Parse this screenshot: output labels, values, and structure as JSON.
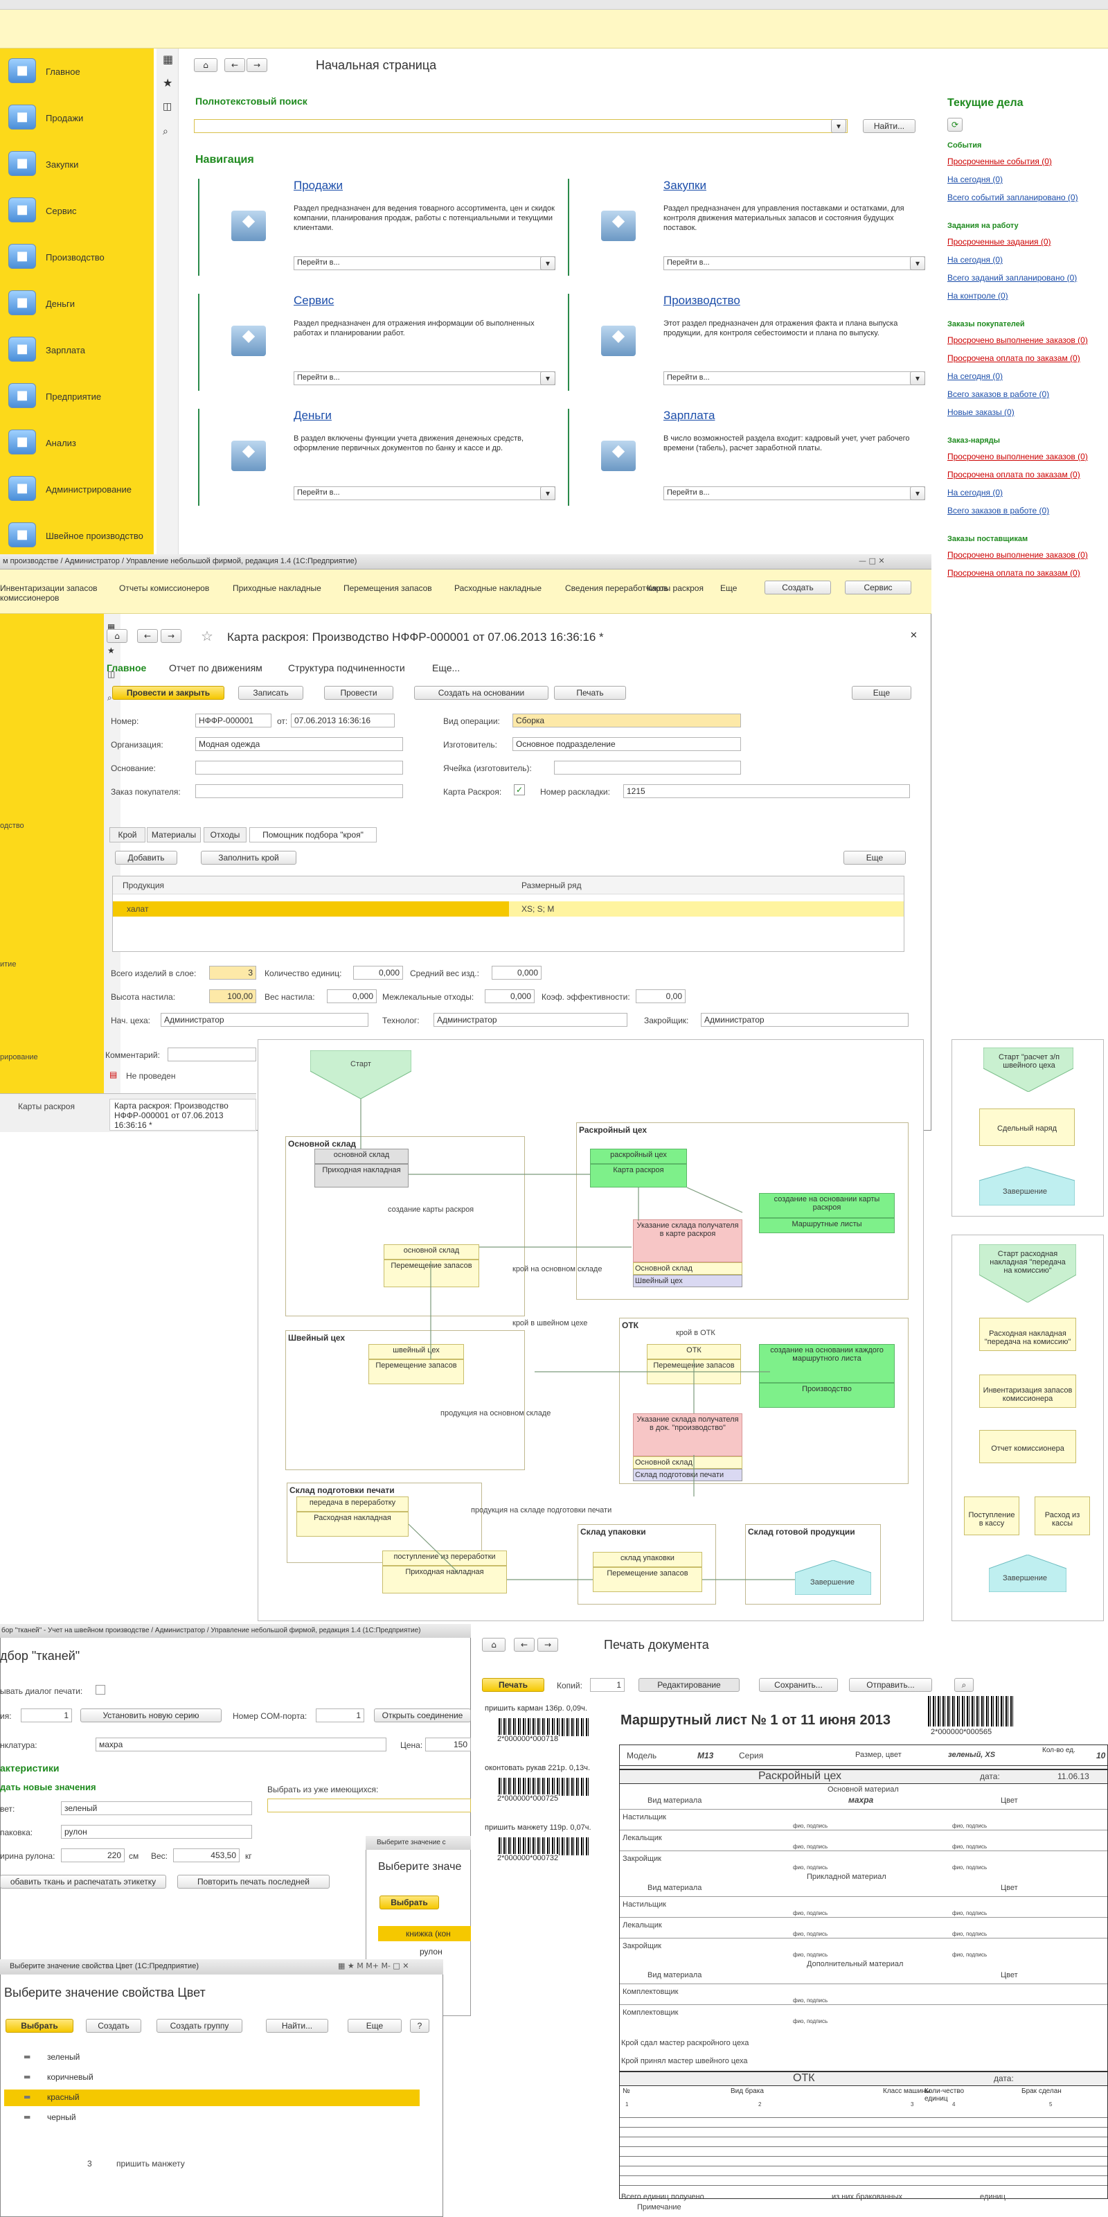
{
  "home": {
    "sidebar": [
      {
        "label": "Главное",
        "icon": "home-icon"
      },
      {
        "label": "Продажи",
        "icon": "cash-register-icon"
      },
      {
        "label": "Закупки",
        "icon": "boxes-icon"
      },
      {
        "label": "Сервис",
        "icon": "tools-icon"
      },
      {
        "label": "Производство",
        "icon": "factory-icon"
      },
      {
        "label": "Деньги",
        "icon": "money-bags-icon"
      },
      {
        "label": "Зарплата",
        "icon": "person-icon"
      },
      {
        "label": "Предприятие",
        "icon": "building-icon"
      },
      {
        "label": "Анализ",
        "icon": "chart-icon"
      },
      {
        "label": "Администрирование",
        "icon": "computer-icon"
      },
      {
        "label": "Швейное производство",
        "icon": "sewing-machine-icon"
      }
    ],
    "title": "Начальная страница",
    "search_heading": "Полнотекстовый поиск",
    "find_btn": "Найти...",
    "nav_heading": "Навигация",
    "goto": "Перейти в...",
    "sections": [
      {
        "title": "Продажи",
        "desc": "Раздел предназначен для ведения товарного ассортимента, цен и скидок компании, планирования продаж, работы с потенциальными и текущими клиентами."
      },
      {
        "title": "Закупки",
        "desc": "Раздел предназначен для управления поставками и остатками, для контроля движения материальных запасов и состояния будущих поставок."
      },
      {
        "title": "Сервис",
        "desc": "Раздел предназначен для отражения информации об выполненных работах и планировании работ."
      },
      {
        "title": "Производство",
        "desc": "Этот раздел предназначен для отражения факта и плана выпуска продукции, для контроля себестоимости и плана по выпуску."
      },
      {
        "title": "Деньги",
        "desc": "В раздел включены функции учета движения денежных средств, оформление первичных документов по банку и кассе и др."
      },
      {
        "title": "Зарплата",
        "desc": "В число возможностей раздела входит: кадровый учет, учет рабочего времени (табель), расчет заработной платы."
      }
    ],
    "current_heading": "Текущие дела",
    "groups": [
      {
        "title": "События",
        "items": [
          {
            "t": "Просроченные события (0)",
            "red": true
          },
          {
            "t": "На сегодня (0)"
          },
          {
            "t": "Всего событий запланировано (0)"
          }
        ]
      },
      {
        "title": "Задания на работу",
        "items": [
          {
            "t": "Просроченные задания (0)",
            "red": true
          },
          {
            "t": "На сегодня (0)"
          },
          {
            "t": "Всего заданий запланировано (0)"
          },
          {
            "t": "На контроле (0)"
          }
        ]
      },
      {
        "title": "Заказы покупателей",
        "items": [
          {
            "t": "Просрочено выполнение заказов (0)",
            "red": true
          },
          {
            "t": "Просрочена оплата по заказам (0)",
            "red": true
          },
          {
            "t": "На сегодня (0)"
          },
          {
            "t": "Всего заказов в работе (0)"
          },
          {
            "t": "Новые заказы (0)"
          }
        ]
      },
      {
        "title": "Заказ-наряды",
        "items": [
          {
            "t": "Просрочено выполнение заказов (0)",
            "red": true
          },
          {
            "t": "Просрочена оплата по заказам (0)",
            "red": true
          },
          {
            "t": "На сегодня (0)"
          },
          {
            "t": "Всего заказов в работе (0)"
          }
        ]
      },
      {
        "title": "Заказы поставщикам",
        "items": [
          {
            "t": "Просрочено выполнение заказов (0)",
            "red": true
          },
          {
            "t": "Просрочена оплата по заказам (0)",
            "red": true
          }
        ]
      }
    ]
  },
  "doc": {
    "window_title": "м производстве / Администратор / Управление небольшой фирмой, редакция 1.4 (1С:Предприятие)",
    "toolbar": [
      "Инвентаризации запасов комиссионеров",
      "Отчеты комиссионеров",
      "Приходные накладные",
      "Перемещения запасов",
      "Расходные накладные",
      "Сведения переработчиков",
      "Карты раскроя",
      "Еще",
      "Создать",
      "Сервис"
    ],
    "title": "Карта раскроя: Производство НФФР-000001 от 07.06.2013 16:36:16 *",
    "tabs": [
      "Главное",
      "Отчет по движениям",
      "Структура подчиненности",
      "Еще..."
    ],
    "actions": [
      "Провести и закрыть",
      "Записать",
      "Провести",
      "Создать на основании",
      "Печать",
      "Еще"
    ],
    "fields": {
      "num_lbl": "Номер:",
      "num": "НФФР-000001",
      "date_lbl": "от:",
      "date": "07.06.2013 16:36:16",
      "op_lbl": "Вид операции:",
      "op": "Сборка",
      "org_lbl": "Организация:",
      "org": "Модная одежда",
      "maker_lbl": "Изготовитель:",
      "maker": "Основное подразделение",
      "base_lbl": "Основание:",
      "cell_lbl": "Ячейка (изготовитель):",
      "order_lbl": "Заказ покупателя:",
      "card_lbl": "Карта Раскроя:",
      "layout_lbl": "Номер раскладки:",
      "layout": "1215"
    },
    "subtabs": [
      "Крой",
      "Материалы",
      "Отходы",
      "Помощник подбора \"кроя\""
    ],
    "add": "Добавить",
    "fill": "Заполнить крой",
    "more": "Еще",
    "cols": [
      "Продукция",
      "Размерный ряд"
    ],
    "row": [
      "халат",
      "XS; S; M"
    ],
    "totals": {
      "items_lbl": "Всего изделий в слое:",
      "items": "3",
      "units_lbl": "Количество единиц:",
      "units": "0,000",
      "avg_lbl": "Средний вес изд.:",
      "avg": "0,000",
      "h_lbl": "Высота настила:",
      "h": "100,00",
      "w_lbl": "Вес настила:",
      "w": "0,000",
      "waste_lbl": "Межлекальные отходы:",
      "waste": "0,000",
      "eff_lbl": "Коэф. эффективности:",
      "eff": "0,00"
    },
    "chief_lbl": "Нач. цеха:",
    "chief": "Администратор",
    "tech_lbl": "Технолог:",
    "tech": "Администратор",
    "cutter_lbl": "Закройщик:",
    "cutter": "Администратор",
    "comment_lbl": "Комментарий:",
    "status": "Не проведен",
    "bottom_tabs": [
      "Карты раскроя",
      "Карта раскроя: Производство НФФР-000001 от 07.06.2013 16:36:16 *"
    ],
    "left_partial": [
      "одство",
      "итие",
      "рирование"
    ]
  },
  "flow": {
    "start": "Старт",
    "regions": [
      "Основной склад",
      "Раскройный цех",
      "Швейный цех",
      "ОТК",
      "Склад подготовки печати",
      "Склад упаковки",
      "Склад готовой продукции"
    ],
    "boxes": {
      "sklad_main": "основной склад",
      "prih": "Приходная накладная",
      "rask_ceh": "раскройный цех",
      "karta": "Карта раскроя",
      "osn_sklad2": "основной склад",
      "perem": "Перемещение запасов",
      "sozd1": "создание на основании карты раскроя",
      "mlist": "Маршрутные листы",
      "ukaz1": "Указание склада получателя в карте раскроя",
      "os1": "Основной склад",
      "sh1": "Швейный цех",
      "shv": "швейный цех",
      "perem2": "Перемещение запасов",
      "otk": "ОТК",
      "perem3": "Перемещение запасов",
      "sozd2": "создание на основании каждого маршрутного листа",
      "proizv": "Производство",
      "ukaz2": "Указание склада получателя в док. \"производство\"",
      "os2": "Основной склад",
      "spp": "Склад подготовки печати",
      "pered": "передача в переработку",
      "rash": "Расходная накладная",
      "post": "поступление из переработки",
      "prih2": "Приходная накладная",
      "upak": "склад упаковки",
      "perem4": "Перемещение запасов",
      "zav": "Завершение"
    },
    "edges": [
      "создание карты раскроя",
      "крой на основном складе",
      "крой в швейном цехе",
      "крой в ОТК",
      "продукция на основном складе",
      "продукция на складе подготовки печати"
    ]
  },
  "side": {
    "start1": "Старт \"расчет з/п швейного цеха",
    "sd": "Сдельный наряд",
    "end1": "Завершение",
    "start2": "Старт расходная накладная \"передача на комиссию\"",
    "rn": "Расходная накладная \"передача на комиссию\"",
    "inv": "Инвентаризация запасов комиссионера",
    "otch": "Отчет комиссионера",
    "post": "Поступление в кассу",
    "rash": "Расход из кассы",
    "end2": "Завершение"
  },
  "tkani": {
    "title_bar": "бор \"тканей\" - Учет на швейном производстве / Администратор / Управление небольшой фирмой, редакция 1.4 (1С:Предприятие)",
    "title": "дбор \"тканей\"",
    "show_dialog": "ывать диалог печати:",
    "copies_lbl": "ия:",
    "copies": "1",
    "new_series": "Установить новую серию",
    "com_lbl": "Номер COM-порта:",
    "com": "1",
    "open_conn": "Открыть соединение",
    "nom_lbl": "нклатура:",
    "nom": "махра",
    "price_lbl": "Цена:",
    "price": "150",
    "char_hd": "актеристики",
    "new_vals": "дать новые значения",
    "choose_existing": "Выбрать из уже имеющихся:",
    "color_lbl": "вет:",
    "color": "зеленый",
    "pack_lbl": "паковка:",
    "pack": "рулон",
    "width_lbl": "ирина рулона:",
    "width": "220",
    "cm": "см",
    "weight_lbl": "Вес:",
    "weight": "453,50",
    "kg": "кг",
    "add_print": "обавить ткань и распечатать этикетку",
    "repeat": "Повторить печать последней",
    "sub_title": "Выберите значе",
    "sub_win": "Выберите значение с",
    "sub_choose": "Выбрать",
    "sub_items": [
      "книжка (кон",
      "рулон"
    ]
  },
  "color_dlg": {
    "bar": "Выберите значение свойства Цвет (1С:Предприятие)",
    "title": "Выберите значение свойства Цвет",
    "btns": [
      "Выбрать",
      "Создать",
      "Создать группу",
      "Найти...",
      "Еще",
      "?"
    ],
    "items": [
      "зеленый",
      "коричневый",
      "красный",
      "черный"
    ],
    "row_num": "3",
    "row_txt": "пришить манжету"
  },
  "print": {
    "title": "Печать документа",
    "print": "Печать",
    "copies_lbl": "Копий:",
    "copies": "1",
    "edit": "Редактирование",
    "save": "Сохранить...",
    "send": "Отправить...",
    "labels": [
      {
        "t": "пришить карман 136р. 0,09ч.",
        "code": "2*000000*000718"
      },
      {
        "t": "оконтовать рукав 221р. 0,13ч.",
        "code": "2*000000*000725"
      },
      {
        "t": "пришить манжету 119р. 0,07ч.",
        "code": "2*000000*000732"
      }
    ],
    "heading": "Маршрутный лист № 1 от 11 июня 2013",
    "barcode": "2*000000*000565",
    "model_lbl": "Модель",
    "model": "М13",
    "series_lbl": "Серия",
    "size_lbl": "Размер, цвет",
    "size": "зеленый, XS",
    "qty_lbl": "Кол-во ед.",
    "qty": "10",
    "ceh": "Раскройный цех",
    "date_lbl": "дата:",
    "date": "11.06.13",
    "main_mat": "Основной материал",
    "mat_kind": "Вид материала",
    "mat": "махра",
    "color": "Цвет",
    "roles": [
      "Настильщик",
      "Лекальщик",
      "Закройщик"
    ],
    "fio": "фио, подпись",
    "app_mat": "Прикладной материал",
    "add_mat": "Дополнительный материал",
    "kompl": "Комплектовщик",
    "sdal": "Крой сдал мастер раскройного цеха",
    "prinyal": "Крой принял мастер швейного цеха",
    "otk": "ОТК",
    "otk_cols": [
      "№",
      "Вид брака",
      "Класс машины",
      "Коли-чество единиц",
      "Брак сделан"
    ],
    "otk_nums": [
      "1",
      "2",
      "3",
      "4",
      "5"
    ],
    "total": "Всего единиц получено",
    "of_which": "из них бракованных",
    "units": "единиц",
    "note": "Примечание"
  }
}
